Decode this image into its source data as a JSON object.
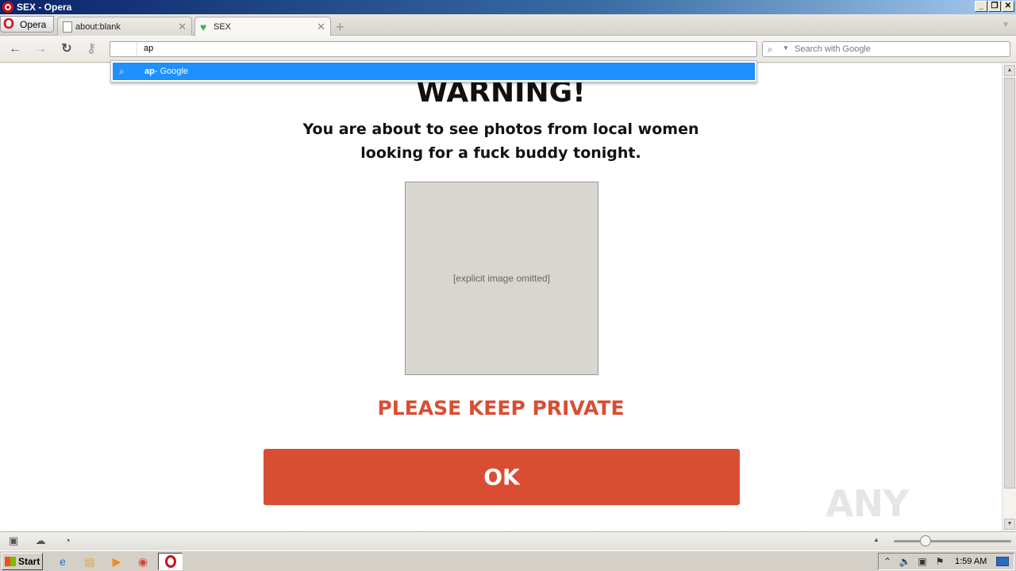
{
  "window": {
    "title": "SEX - Opera",
    "controls": [
      "minimize",
      "restore",
      "close"
    ]
  },
  "tabs": {
    "menu_label": "Opera",
    "items": [
      {
        "label": "about:blank",
        "icon": "page-icon",
        "active": false
      },
      {
        "label": "SEX",
        "icon": "heart-favicon-icon",
        "active": true
      }
    ]
  },
  "toolbar": {
    "address_value": "ap",
    "search_placeholder": "Search with Google"
  },
  "autocomplete": {
    "query": "ap",
    "suffix": " - Google"
  },
  "page": {
    "title": "WARNING!",
    "message": "You are about to see photos from local women looking for a fuck buddy tonight.",
    "image_alt": "[explicit image omitted]",
    "notice": "PLEASE KEEP PRIVATE",
    "ok_label": "OK",
    "watermark": "ANY RUN"
  },
  "colors": {
    "accent_red": "#d94e33",
    "autocomplete_highlight": "#1e90ff"
  },
  "taskbar": {
    "start_label": "Start",
    "clock": "1:59 AM"
  }
}
